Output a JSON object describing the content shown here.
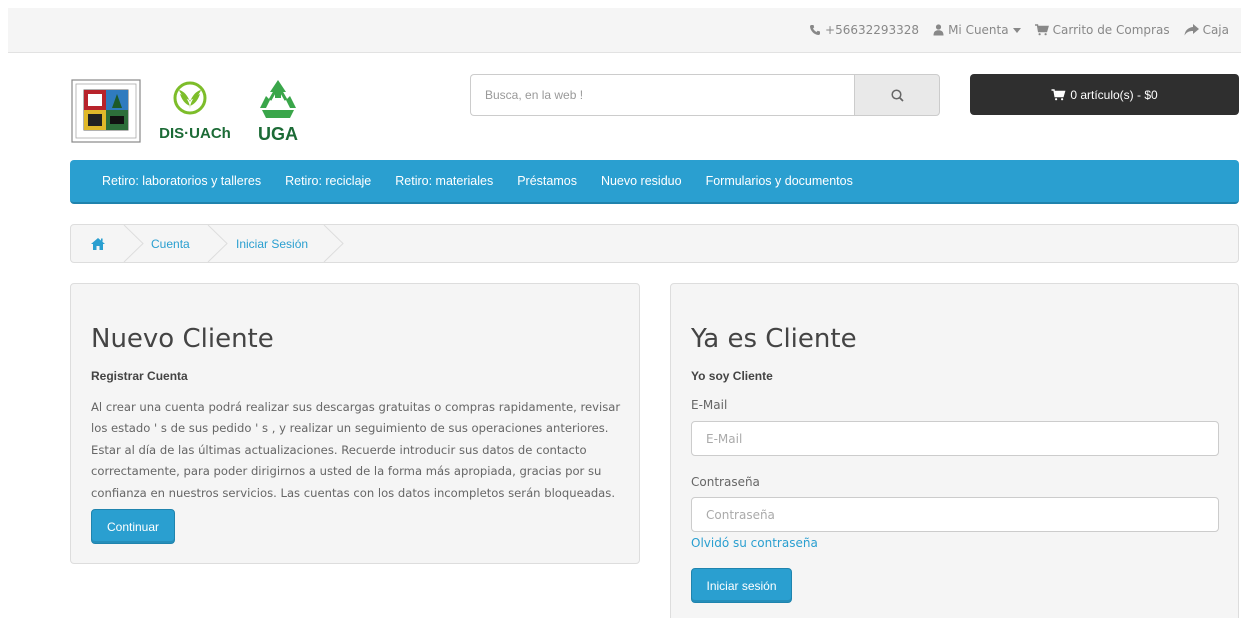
{
  "topbar": {
    "phone": "+56632293328",
    "account_label": "Mi Cuenta",
    "cart_link": "Carrito de Compras",
    "checkout_link": "Caja"
  },
  "logos": {
    "dis_text": "DIS·UACh",
    "uga_text": "UGA"
  },
  "search": {
    "placeholder": "Busca, en la web !"
  },
  "cart": {
    "label": "0 artículo(s) - $0"
  },
  "nav": {
    "items": [
      {
        "label": "Retiro: laboratorios y talleres"
      },
      {
        "label": "Retiro: reciclaje"
      },
      {
        "label": "Retiro: materiales"
      },
      {
        "label": "Préstamos"
      },
      {
        "label": "Nuevo residuo"
      },
      {
        "label": "Formularios y documentos"
      }
    ]
  },
  "breadcrumb": {
    "items": [
      "Cuenta",
      "Iniciar Sesión"
    ]
  },
  "new_customer": {
    "title": "Nuevo Cliente",
    "subtitle": "Registrar Cuenta",
    "lines": [
      "Al crear una cuenta podrá realizar sus descargas gratuitas o compras rapidamente, revisar",
      "los estado ' s de sus pedido ' s , y realizar un seguimiento de sus operaciones anteriores.",
      "Estar al día de las últimas actualizaciones. Recuerde introducir sus datos de contacto",
      "correctamente, para poder dirigirnos a usted de la forma más apropiada, gracias por su",
      "confianza en nuestros servicios. Las cuentas con los datos incompletos serán bloqueadas."
    ],
    "button": "Continuar"
  },
  "returning_customer": {
    "title": "Ya es Cliente",
    "subtitle": "Yo soy Cliente",
    "email_label": "E-Mail",
    "email_placeholder": "E-Mail",
    "password_label": "Contraseña",
    "password_placeholder": "Contraseña",
    "forgot": "Olvidó su contraseña",
    "button": "Iniciar sesión"
  },
  "colors": {
    "accent": "#2a9fd0",
    "cart_bg": "#2f2f2f"
  }
}
